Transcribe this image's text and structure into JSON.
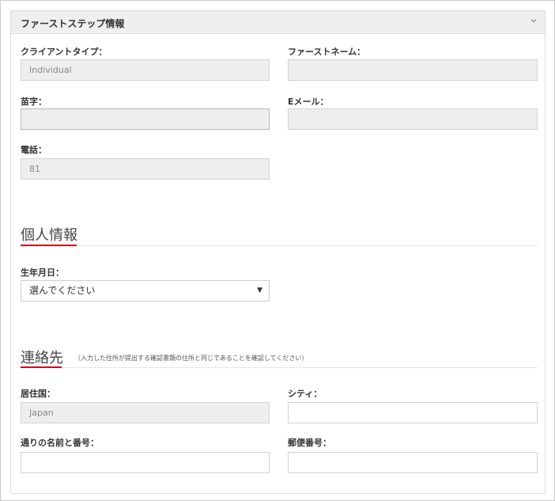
{
  "panel": {
    "title": "ファーストステップ情報"
  },
  "first_step": {
    "client_type": {
      "label": "クライアントタイプ：",
      "value": "Individual"
    },
    "first_name": {
      "label": "ファーストネーム：",
      "value": ""
    },
    "last_name": {
      "label": "苗字：",
      "value": ""
    },
    "email": {
      "label": "Eメール：",
      "value": ""
    },
    "phone": {
      "label": "電話：",
      "value": "81"
    }
  },
  "personal_info": {
    "title": "個人情報",
    "birthdate": {
      "label": "生年月日：",
      "selected": "選んでください"
    }
  },
  "contact": {
    "title": "連絡先",
    "note": "（入力した住所が提出する確認書類の住所と同じであることを確認してください）",
    "country": {
      "label": "居住国：",
      "value": "Japan"
    },
    "city": {
      "label": "シティ：",
      "value": ""
    },
    "street": {
      "label": "通りの名前と番号：",
      "value": ""
    },
    "postal": {
      "label": "郵便番号：",
      "value": ""
    }
  },
  "icons": {
    "collapse": "chevron-down-icon",
    "dropdown": "caret-down-icon"
  },
  "colors": {
    "accent": "#d0021b",
    "disabled_bg": "#eeeeee",
    "header_bg": "#efefef"
  }
}
